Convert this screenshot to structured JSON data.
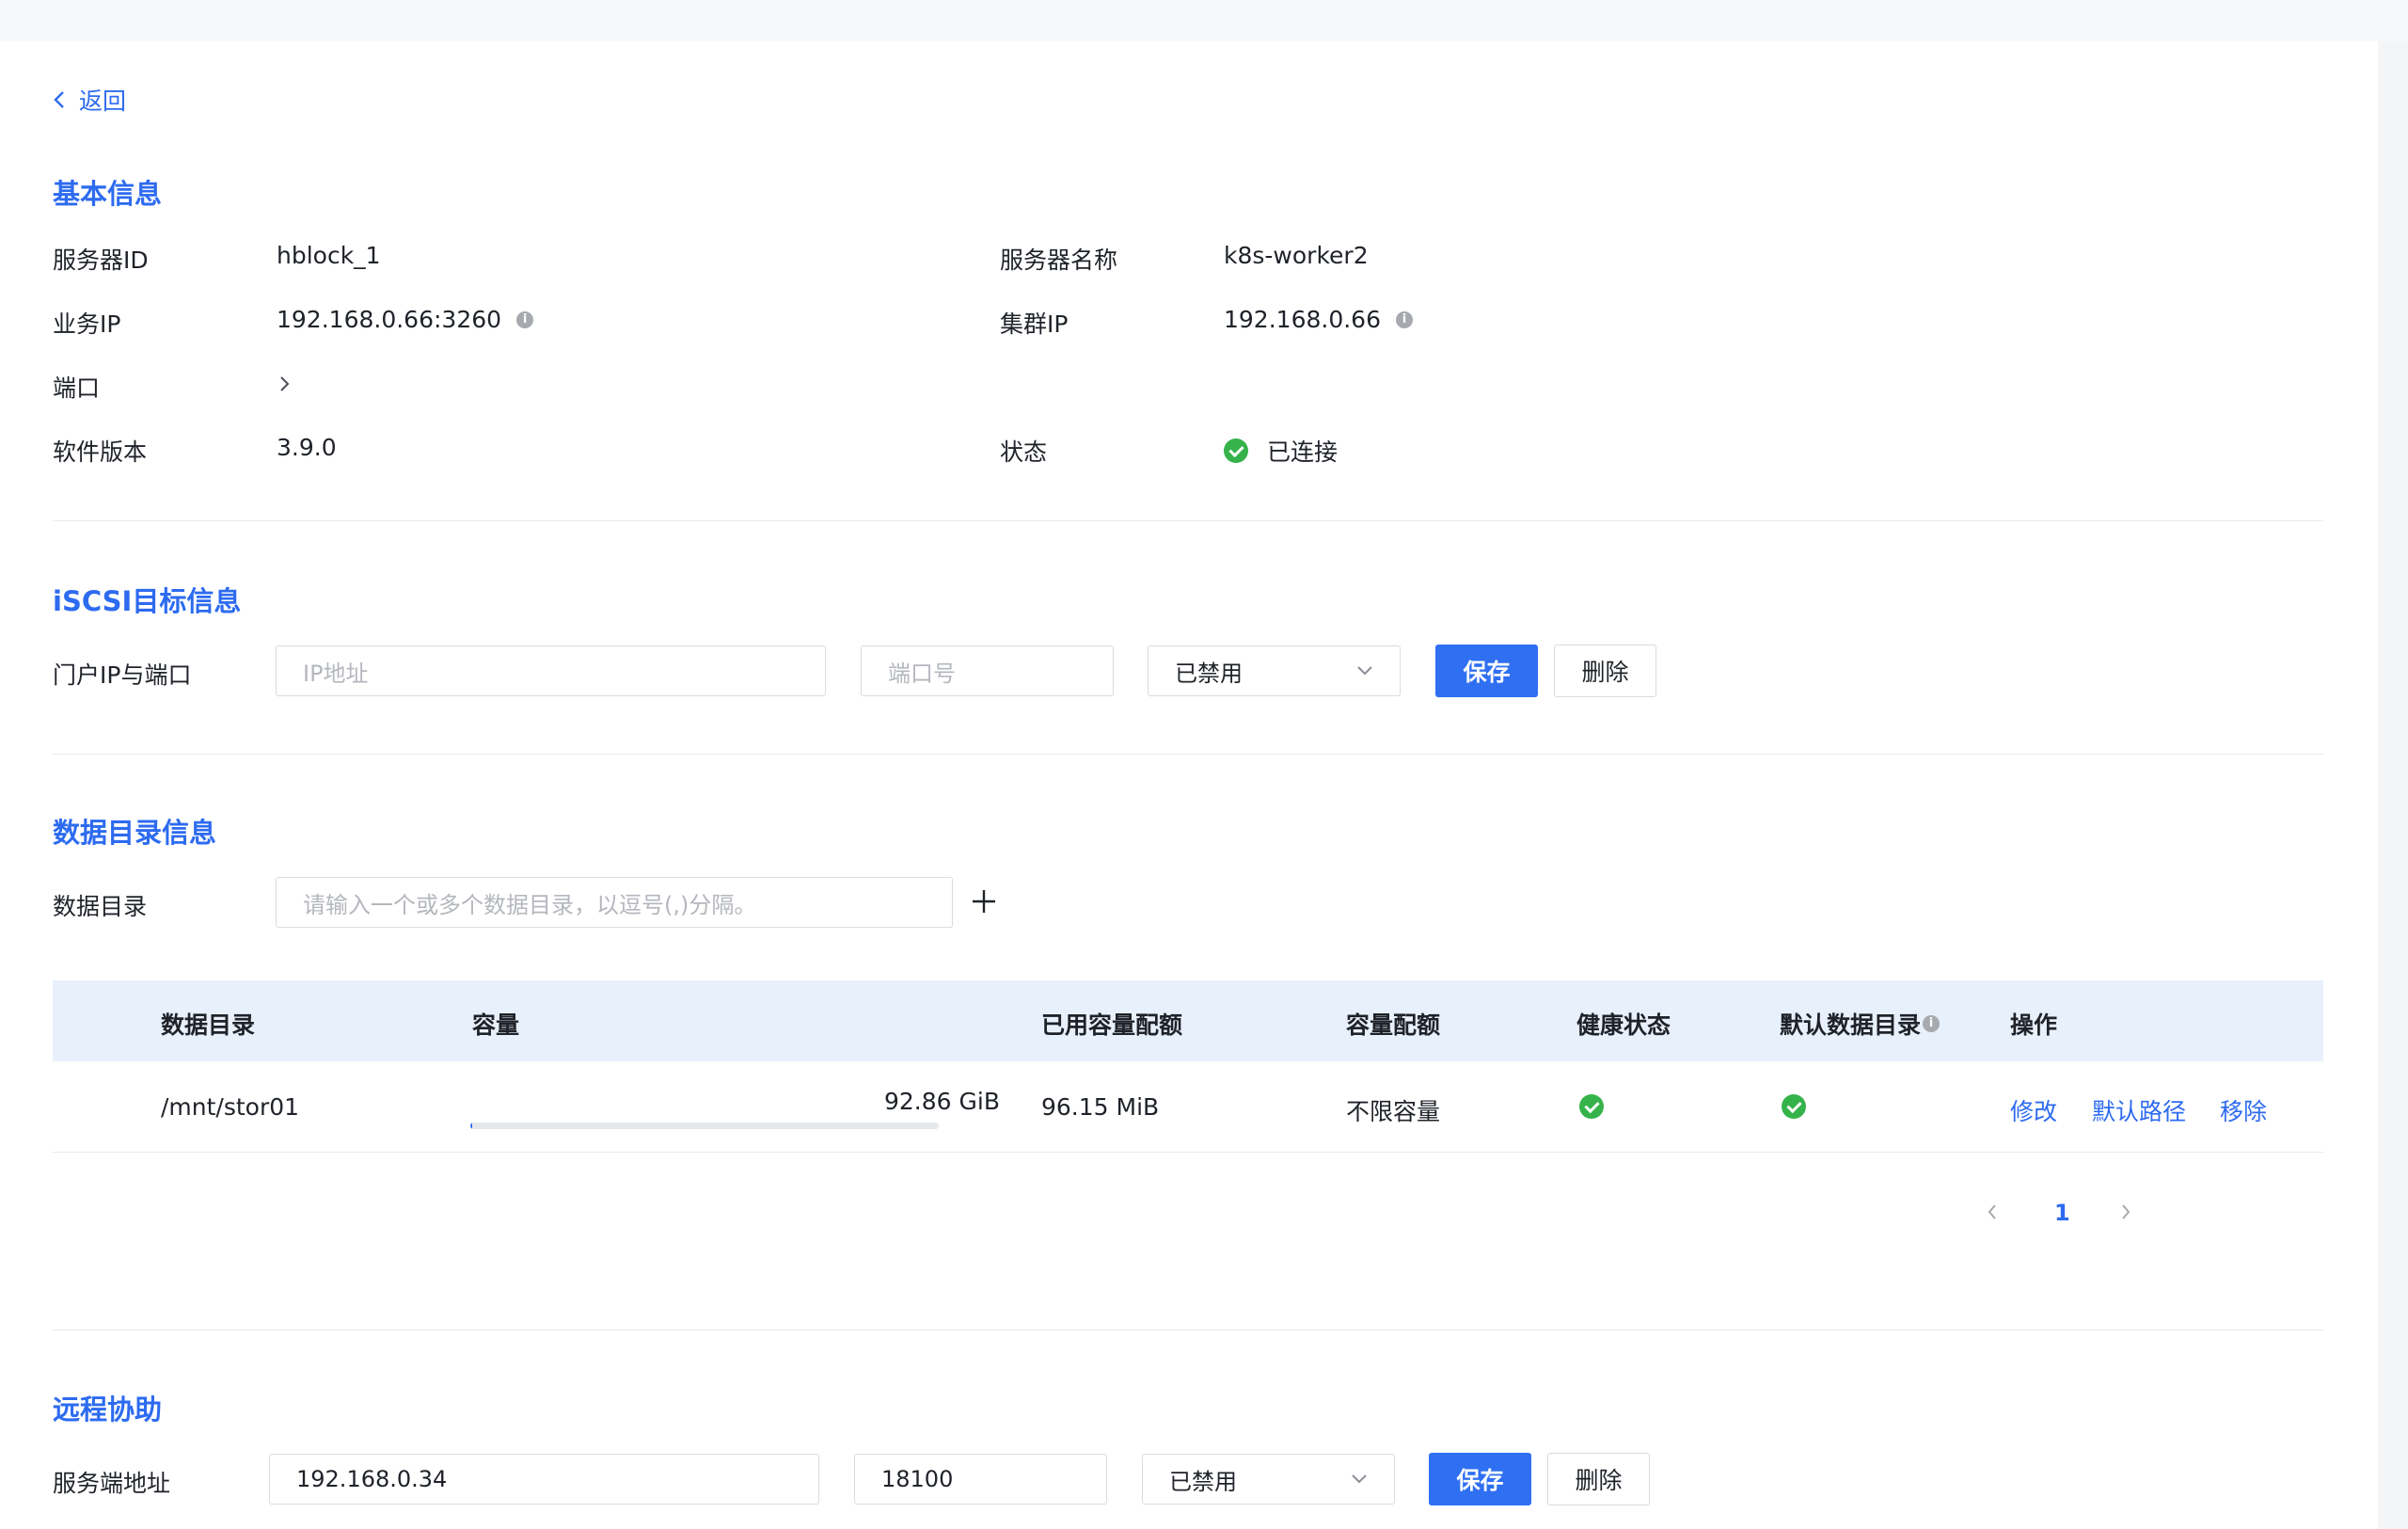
{
  "nav": {
    "back_label": "返回"
  },
  "basic": {
    "title": "基本信息",
    "server_id_label": "服务器ID",
    "server_id": "hblock_1",
    "server_name_label": "服务器名称",
    "server_name": "k8s-worker2",
    "biz_ip_label": "业务IP",
    "biz_ip": "192.168.0.66:3260",
    "cluster_ip_label": "集群IP",
    "cluster_ip": "192.168.0.66",
    "port_label": "端口",
    "version_label": "软件版本",
    "version": "3.9.0",
    "status_label": "状态",
    "status": "已连接",
    "status_color": "#35b34a"
  },
  "iscsi": {
    "title": "iSCSI目标信息",
    "portal_label": "门户IP与端口",
    "ip_placeholder": "IP地址",
    "port_placeholder": "端口号",
    "select_value": "已禁用",
    "save_label": "保存",
    "delete_label": "删除"
  },
  "datadir": {
    "title": "数据目录信息",
    "dir_label": "数据目录",
    "dir_placeholder": "请输入一个或多个数据目录，以逗号(,)分隔。",
    "add_icon": "plus-icon",
    "columns": [
      "数据目录",
      "容量",
      "已用容量配额",
      "容量配额",
      "健康状态",
      "默认数据目录",
      "操作"
    ],
    "rows": [
      {
        "path": "/mnt/stor01",
        "capacity": "92.86 GiB",
        "used_fraction": 0.001,
        "used_quota": "96.15 MiB",
        "quota": "不限容量",
        "health": "ok",
        "default": "ok",
        "actions": [
          "修改",
          "默认路径",
          "移除"
        ]
      }
    ],
    "pagination": {
      "current": "1"
    }
  },
  "remote": {
    "title": "远程协助",
    "server_label": "服务端地址",
    "server_ip": "192.168.0.34",
    "server_port": "18100",
    "select_value": "已禁用",
    "save_label": "保存",
    "delete_label": "删除"
  },
  "colors": {
    "accent": "#2d6bf0",
    "primary_button": "#2f6ff2",
    "table_header_bg": "#e8f0fc"
  }
}
